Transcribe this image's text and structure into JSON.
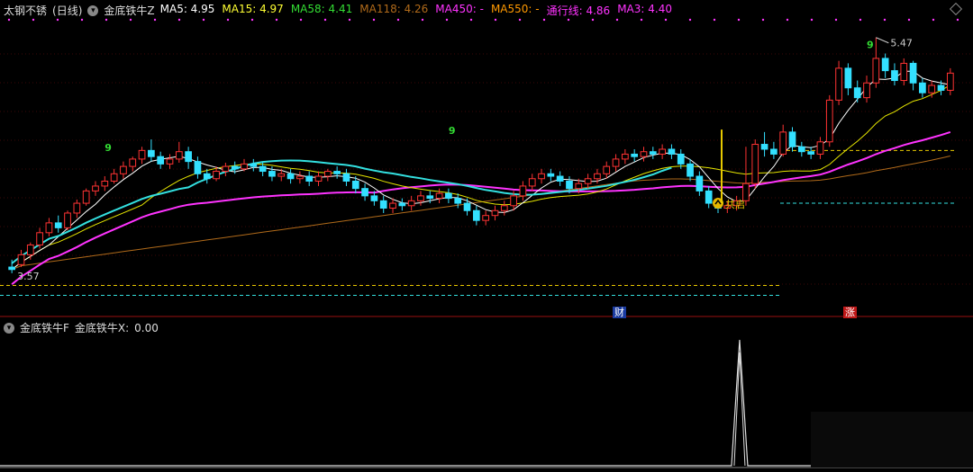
{
  "header": {
    "stock": "太钢不锈",
    "period": "(日线)",
    "indicator": "金底铁牛Z",
    "ma": [
      {
        "label": "MA5:",
        "value": "4.95",
        "color": "#ffffff"
      },
      {
        "label": "MA15:",
        "value": "4.97",
        "color": "#ffff33"
      },
      {
        "label": "MA58:",
        "value": "4.41",
        "color": "#33dd33"
      },
      {
        "label": "MA118:",
        "value": "4.26",
        "color": "#b06a1a"
      },
      {
        "label": "MA450:",
        "value": "-",
        "color": "#ff33ff"
      },
      {
        "label": "MA550:",
        "value": "-",
        "color": "#ff9900"
      },
      {
        "label": "通行线:",
        "value": "4.86",
        "color": "#ff33ff"
      },
      {
        "label": "MA3:",
        "value": "4.40",
        "color": "#ff33ff"
      }
    ]
  },
  "subheader": {
    "indicator": "金底铁牛F",
    "value_label": "金底铁牛X:",
    "value": "0.00"
  },
  "annotations": {
    "high": "5.47",
    "low": "3.57",
    "nine": "9",
    "signal": "共启",
    "fin_tag": "财",
    "rise_tag": "涨"
  },
  "colors": {
    "up": "#ff3333",
    "down": "#33e0ff",
    "ma5": "#ffffff",
    "ma15": "#e6e600",
    "ma58": "#ff33ff",
    "ma118": "#b06a1a",
    "cyan_ma": "#33e0e0",
    "grid": "#7a1010"
  },
  "chart_data": [
    {
      "type": "candlestick",
      "ylim": [
        3.3,
        5.6
      ],
      "high": 5.47,
      "low": 3.57,
      "levels": [
        {
          "value": 4.55,
          "color": "#e6c800",
          "style": "dashed"
        },
        {
          "value": 4.12,
          "color": "#33e0e0",
          "style": "dashed"
        },
        {
          "value": 3.45,
          "color": "#e6c800",
          "style": "dashed"
        },
        {
          "value": 3.37,
          "color": "#33e0e0",
          "style": "dashed"
        }
      ],
      "candles": [
        [
          3.6,
          3.58,
          3.66,
          3.55
        ],
        [
          3.62,
          3.7,
          3.74,
          3.6
        ],
        [
          3.7,
          3.78,
          3.8,
          3.66
        ],
        [
          3.78,
          3.88,
          3.92,
          3.75
        ],
        [
          3.88,
          3.96,
          4.0,
          3.85
        ],
        [
          3.96,
          3.92,
          4.02,
          3.88
        ],
        [
          3.92,
          4.04,
          4.06,
          3.9
        ],
        [
          4.04,
          4.12,
          4.15,
          4.0
        ],
        [
          4.12,
          4.22,
          4.24,
          4.1
        ],
        [
          4.22,
          4.26,
          4.3,
          4.18
        ],
        [
          4.26,
          4.3,
          4.34,
          4.22
        ],
        [
          4.3,
          4.36,
          4.4,
          4.28
        ],
        [
          4.36,
          4.42,
          4.46,
          4.32
        ],
        [
          4.42,
          4.48,
          4.5,
          4.38
        ],
        [
          4.48,
          4.55,
          4.58,
          4.44
        ],
        [
          4.55,
          4.5,
          4.64,
          4.46
        ],
        [
          4.5,
          4.44,
          4.54,
          4.4
        ],
        [
          4.44,
          4.48,
          4.52,
          4.4
        ],
        [
          4.48,
          4.54,
          4.62,
          4.45
        ],
        [
          4.54,
          4.46,
          4.58,
          4.4
        ],
        [
          4.46,
          4.36,
          4.5,
          4.32
        ],
        [
          4.36,
          4.32,
          4.4,
          4.28
        ],
        [
          4.32,
          4.38,
          4.42,
          4.3
        ],
        [
          4.38,
          4.42,
          4.45,
          4.34
        ],
        [
          4.42,
          4.4,
          4.46,
          4.36
        ],
        [
          4.4,
          4.44,
          4.48,
          4.38
        ],
        [
          4.44,
          4.42,
          4.48,
          4.38
        ],
        [
          4.42,
          4.38,
          4.46,
          4.34
        ],
        [
          4.38,
          4.34,
          4.42,
          4.3
        ],
        [
          4.34,
          4.36,
          4.4,
          4.3
        ],
        [
          4.36,
          4.32,
          4.4,
          4.28
        ],
        [
          4.32,
          4.34,
          4.38,
          4.28
        ],
        [
          4.34,
          4.3,
          4.38,
          4.26
        ],
        [
          4.3,
          4.34,
          4.38,
          4.26
        ],
        [
          4.34,
          4.38,
          4.4,
          4.3
        ],
        [
          4.38,
          4.36,
          4.42,
          4.32
        ],
        [
          4.36,
          4.3,
          4.4,
          4.26
        ],
        [
          4.3,
          4.24,
          4.34,
          4.2
        ],
        [
          4.24,
          4.18,
          4.28,
          4.14
        ],
        [
          4.18,
          4.14,
          4.22,
          4.1
        ],
        [
          4.14,
          4.08,
          4.18,
          4.04
        ],
        [
          4.08,
          4.12,
          4.16,
          4.04
        ],
        [
          4.12,
          4.1,
          4.16,
          4.06
        ],
        [
          4.1,
          4.14,
          4.18,
          4.06
        ],
        [
          4.14,
          4.18,
          4.22,
          4.1
        ],
        [
          4.18,
          4.16,
          4.22,
          4.12
        ],
        [
          4.16,
          4.2,
          4.24,
          4.12
        ],
        [
          4.2,
          4.16,
          4.24,
          4.12
        ],
        [
          4.16,
          4.12,
          4.2,
          4.08
        ],
        [
          4.12,
          4.06,
          4.16,
          4.02
        ],
        [
          4.06,
          3.98,
          4.1,
          3.94
        ],
        [
          3.98,
          4.02,
          4.06,
          3.94
        ],
        [
          4.02,
          4.06,
          4.1,
          3.98
        ],
        [
          4.06,
          4.1,
          4.14,
          4.02
        ],
        [
          4.1,
          4.18,
          4.22,
          4.06
        ],
        [
          4.18,
          4.26,
          4.3,
          4.14
        ],
        [
          4.26,
          4.32,
          4.36,
          4.22
        ],
        [
          4.32,
          4.36,
          4.4,
          4.28
        ],
        [
          4.36,
          4.34,
          4.4,
          4.3
        ],
        [
          4.34,
          4.3,
          4.38,
          4.26
        ],
        [
          4.3,
          4.24,
          4.34,
          4.2
        ],
        [
          4.24,
          4.28,
          4.32,
          4.2
        ],
        [
          4.28,
          4.32,
          4.36,
          4.24
        ],
        [
          4.32,
          4.36,
          4.4,
          4.28
        ],
        [
          4.36,
          4.42,
          4.46,
          4.32
        ],
        [
          4.42,
          4.48,
          4.52,
          4.38
        ],
        [
          4.48,
          4.52,
          4.56,
          4.44
        ],
        [
          4.52,
          4.5,
          4.56,
          4.46
        ],
        [
          4.5,
          4.54,
          4.58,
          4.46
        ],
        [
          4.54,
          4.52,
          4.58,
          4.48
        ],
        [
          4.52,
          4.56,
          4.6,
          4.48
        ],
        [
          4.56,
          4.52,
          4.6,
          4.48
        ],
        [
          4.52,
          4.44,
          4.56,
          4.4
        ],
        [
          4.44,
          4.34,
          4.48,
          4.3
        ],
        [
          4.34,
          4.22,
          4.38,
          4.18
        ],
        [
          4.22,
          4.12,
          4.26,
          4.08
        ],
        [
          4.12,
          4.08,
          4.16,
          4.04
        ],
        [
          4.08,
          4.1,
          4.14,
          4.04
        ],
        [
          4.1,
          4.14,
          4.18,
          4.06
        ],
        [
          4.14,
          4.28,
          4.58,
          4.1
        ],
        [
          4.28,
          4.6,
          4.64,
          4.24
        ],
        [
          4.6,
          4.56,
          4.7,
          4.5
        ],
        [
          4.56,
          4.52,
          4.62,
          4.48
        ],
        [
          4.52,
          4.7,
          4.76,
          4.5
        ],
        [
          4.7,
          4.58,
          4.74,
          4.54
        ],
        [
          4.58,
          4.54,
          4.62,
          4.5
        ],
        [
          4.54,
          4.52,
          4.58,
          4.48
        ],
        [
          4.52,
          4.62,
          4.66,
          4.48
        ],
        [
          4.62,
          4.96,
          5.0,
          4.58
        ],
        [
          4.96,
          5.22,
          5.28,
          4.92
        ],
        [
          5.22,
          5.06,
          5.26,
          5.0
        ],
        [
          5.06,
          4.98,
          5.12,
          4.94
        ],
        [
          4.98,
          5.1,
          5.16,
          4.94
        ],
        [
          5.1,
          5.3,
          5.47,
          5.06
        ],
        [
          5.3,
          5.2,
          5.34,
          5.14
        ],
        [
          5.2,
          5.12,
          5.26,
          5.08
        ],
        [
          5.12,
          5.26,
          5.3,
          5.08
        ],
        [
          5.26,
          5.1,
          5.28,
          5.04
        ],
        [
          5.1,
          5.02,
          5.14,
          4.98
        ],
        [
          5.02,
          5.08,
          5.12,
          4.98
        ],
        [
          5.08,
          5.04,
          5.12,
          5.0
        ],
        [
          5.04,
          5.18,
          5.22,
          5.0
        ]
      ]
    },
    {
      "type": "line",
      "name": "金底铁牛X",
      "ylim": [
        0,
        1
      ],
      "spike_index": 79,
      "spike_value": 1
    }
  ]
}
